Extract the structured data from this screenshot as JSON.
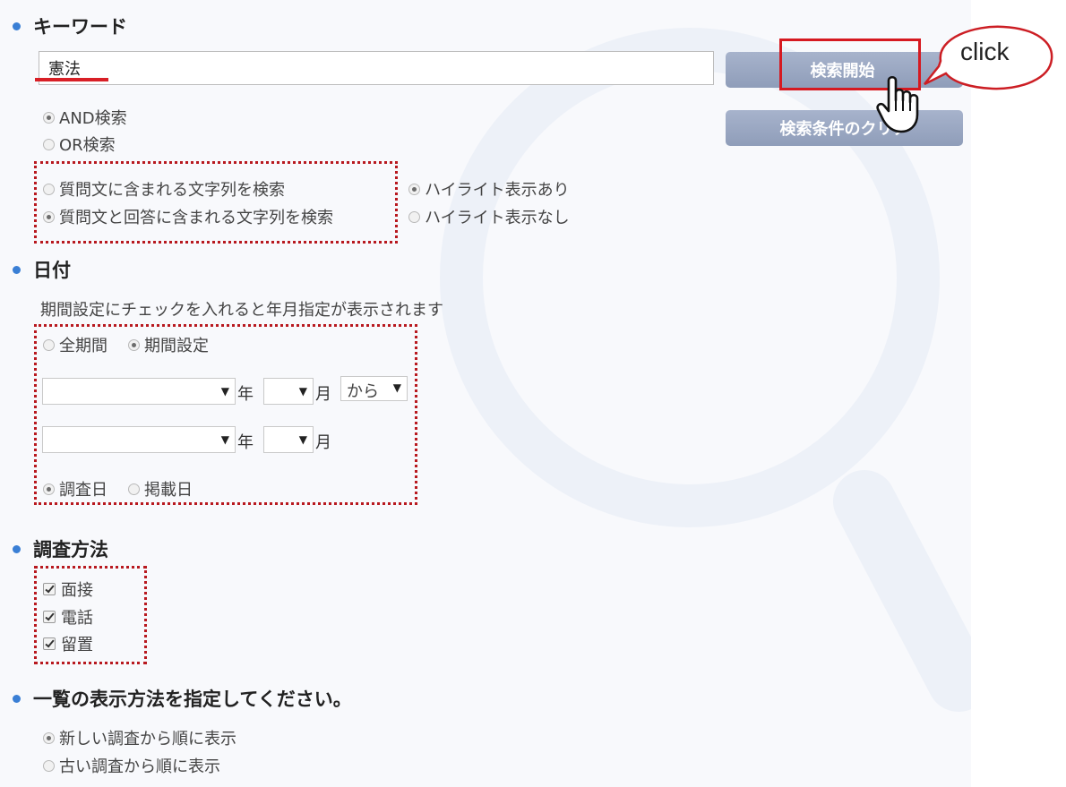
{
  "keyword": {
    "heading": "キーワード",
    "input_value": "憲法",
    "search_button": "検索開始",
    "clear_button": "検索条件のクリア",
    "match_options": [
      {
        "label": "AND検索",
        "selected": true
      },
      {
        "label": "OR検索",
        "selected": false
      }
    ],
    "scope_options": [
      {
        "label": "質問文に含まれる文字列を検索",
        "selected": false
      },
      {
        "label": "質問文と回答に含まれる文字列を検索",
        "selected": true
      }
    ],
    "highlight_options": [
      {
        "label": "ハイライト表示あり",
        "selected": true
      },
      {
        "label": "ハイライト表示なし",
        "selected": false
      }
    ]
  },
  "date": {
    "heading": "日付",
    "help": "期間設定にチェックを入れると年月指定が表示されます",
    "period_options": [
      {
        "label": "全期間",
        "selected": false
      },
      {
        "label": "期間設定",
        "selected": true
      }
    ],
    "year_unit": "年",
    "month_unit": "月",
    "from_select": "から",
    "date_type_options": [
      {
        "label": "調査日",
        "selected": true
      },
      {
        "label": "掲載日",
        "selected": false
      }
    ]
  },
  "method": {
    "heading": "調査方法",
    "options": [
      {
        "label": "面接",
        "checked": true
      },
      {
        "label": "電話",
        "checked": true
      },
      {
        "label": "留置",
        "checked": true
      }
    ]
  },
  "display": {
    "heading": "一覧の表示方法を指定してください。",
    "options": [
      {
        "label": "新しい調査から順に表示",
        "selected": true
      },
      {
        "label": "古い調査から順に表示",
        "selected": false
      }
    ]
  },
  "annotation": {
    "click_label": "click"
  },
  "colors": {
    "accent_bullet": "#3a7fd5",
    "annotation_red": "#d61920",
    "button_gray": "#9aa7c2"
  }
}
